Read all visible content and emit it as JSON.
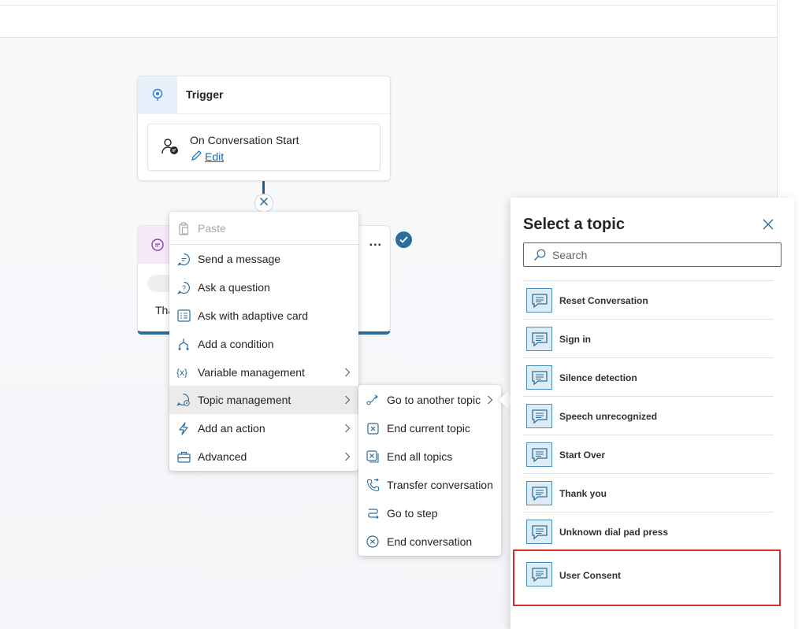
{
  "trigger": {
    "title": "Trigger",
    "event_name": "On Conversation Start",
    "edit_label": "Edit"
  },
  "message_node": {
    "more_label": "...",
    "text_snippet": "Tha"
  },
  "menu": {
    "items": [
      {
        "label": "Paste",
        "icon": "paste-icon",
        "disabled": true
      },
      {
        "label": "Send a message",
        "icon": "message-icon"
      },
      {
        "label": "Ask a question",
        "icon": "question-icon"
      },
      {
        "label": "Ask with adaptive card",
        "icon": "adaptive-card-icon"
      },
      {
        "label": "Add a condition",
        "icon": "condition-icon"
      },
      {
        "label": "Variable management",
        "icon": "variable-icon",
        "submenu": true
      },
      {
        "label": "Topic management",
        "icon": "topic-icon",
        "submenu": true,
        "active": true
      },
      {
        "label": "Add an action",
        "icon": "lightning-icon",
        "submenu": true
      },
      {
        "label": "Advanced",
        "icon": "toolbox-icon",
        "submenu": true
      }
    ]
  },
  "submenu": {
    "items": [
      {
        "label": "Go to another topic",
        "icon": "redirect-icon",
        "submenu": true
      },
      {
        "label": "End current topic",
        "icon": "end-topic-icon"
      },
      {
        "label": "End all topics",
        "icon": "end-all-icon"
      },
      {
        "label": "Transfer conversation",
        "icon": "phone-transfer-icon"
      },
      {
        "label": "Go to step",
        "icon": "go-to-step-icon"
      },
      {
        "label": "End conversation",
        "icon": "end-conversation-icon"
      }
    ]
  },
  "topic_panel": {
    "title": "Select a topic",
    "search_placeholder": "Search",
    "topics": [
      "Reset Conversation",
      "Sign in",
      "Silence detection",
      "Speech unrecognized",
      "Start Over",
      "Thank you",
      "Unknown dial pad press",
      "User Consent"
    ],
    "highlighted_topic": "User Consent",
    "highlight_color": "#d82c2c"
  },
  "colors": {
    "accent": "#0f6cbd",
    "node_border": "#2d6d9a"
  }
}
